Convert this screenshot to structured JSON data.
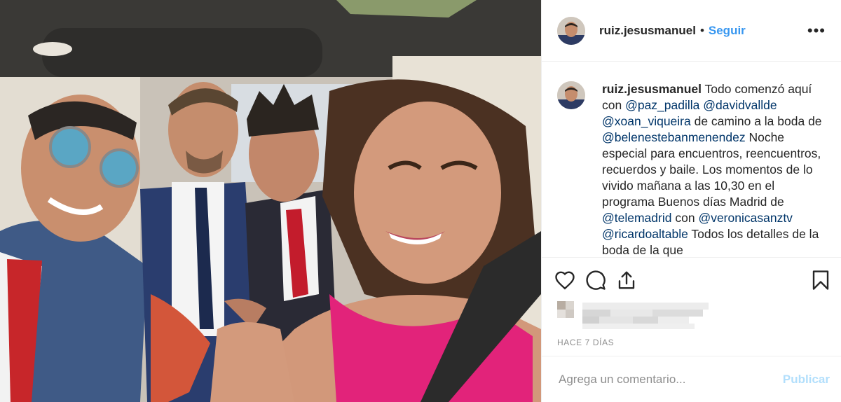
{
  "post": {
    "username": "ruiz.jesusmanuel",
    "separator": "•",
    "follow_label": "Seguir",
    "more_label": "•••",
    "caption": {
      "username": "ruiz.jesusmanuel",
      "segments": [
        {
          "t": " Todo comenzó aquí con ",
          "m": false
        },
        {
          "t": "@paz_padilla",
          "m": true
        },
        {
          "t": " ",
          "m": false
        },
        {
          "t": "@davidvallde",
          "m": true
        },
        {
          "t": " ",
          "m": false
        },
        {
          "t": "@xoan_viqueira",
          "m": true
        },
        {
          "t": " de camino a la boda de ",
          "m": false
        },
        {
          "t": "@belenestebanmenendez",
          "m": true
        },
        {
          "t": " Noche especial para encuentros, reencuentros, recuerdos y baile. Los momentos de lo vivido mañana a las 10,30 en el programa Buenos días Madrid de ",
          "m": false
        },
        {
          "t": "@telemadrid",
          "m": true
        },
        {
          "t": " con ",
          "m": false
        },
        {
          "t": "@veronicasanztv",
          "m": true
        },
        {
          "t": " ",
          "m": false
        },
        {
          "t": "@ricardoaltable",
          "m": true
        },
        {
          "t": " Todos los detalles de la boda de la que",
          "m": false
        }
      ]
    },
    "icons": {
      "like": "heart-icon",
      "comment": "comment-icon",
      "share": "share-icon",
      "save": "bookmark-icon"
    },
    "time_ago": "HACE 7 DÍAS",
    "comment_placeholder": "Agrega un comentario...",
    "publish_label": "Publicar",
    "colors": {
      "accent": "#3897f0",
      "mention": "#003569",
      "publish_disabled": "#b2dffc",
      "muted": "#8e8e8e"
    }
  }
}
